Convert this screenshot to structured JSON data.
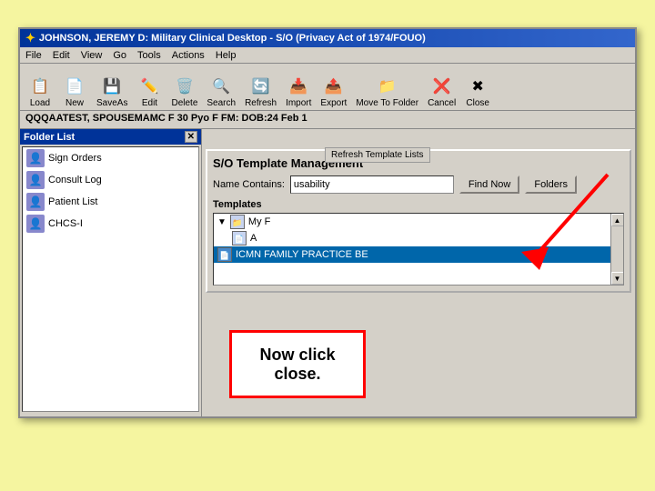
{
  "background_color": "#f5f5a0",
  "title_bar": {
    "icon": "✦",
    "text": "JOHNSON, JEREMY D: Military Clinical Desktop - S/O (Privacy Act of 1974/FOUO)"
  },
  "menu_bar": {
    "items": [
      "File",
      "Edit",
      "View",
      "Go",
      "Tools",
      "Actions",
      "Help"
    ]
  },
  "toolbar": {
    "buttons": [
      {
        "label": "Load",
        "icon": "📋"
      },
      {
        "label": "New",
        "icon": "📄"
      },
      {
        "label": "SaveAs",
        "icon": "💾"
      },
      {
        "label": "Edit",
        "icon": "✏️"
      },
      {
        "label": "Delete",
        "icon": "🗑️"
      },
      {
        "label": "Search",
        "icon": "🔍"
      },
      {
        "label": "Refresh",
        "icon": "🔄"
      },
      {
        "label": "Import",
        "icon": "📥"
      },
      {
        "label": "Export",
        "icon": "📤"
      },
      {
        "label": "Move To Folder",
        "icon": "📁"
      },
      {
        "label": "Cancel",
        "icon": "❌"
      },
      {
        "label": "Close",
        "icon": "✖"
      }
    ]
  },
  "patient_bar": {
    "text": "QQQAATEST, SPOUSEMAMC F 30  Pyo F  FM:  DOB:24 Feb 1"
  },
  "folder_panel": {
    "title": "Folder List",
    "items": [
      {
        "label": "Sign Orders"
      },
      {
        "label": "Consult Log"
      },
      {
        "label": "Patient List"
      },
      {
        "label": "CHCS-I"
      }
    ]
  },
  "template_management": {
    "title": "S/O Template Management",
    "search_label": "Name Contains:",
    "search_value": "usability",
    "find_button": "Find Now",
    "folders_button": "Folders",
    "templates_label": "Templates",
    "template_items": [
      {
        "label": "My F",
        "sub": true
      },
      {
        "label": "A",
        "indent": true
      },
      {
        "label": "ICMN FAMILY PRACTICE BE",
        "indent": false
      }
    ],
    "tooltip": "Refresh Template Lists"
  },
  "annotation": {
    "click_close_text": "Now click\nclose.",
    "arrow_color": "red"
  }
}
